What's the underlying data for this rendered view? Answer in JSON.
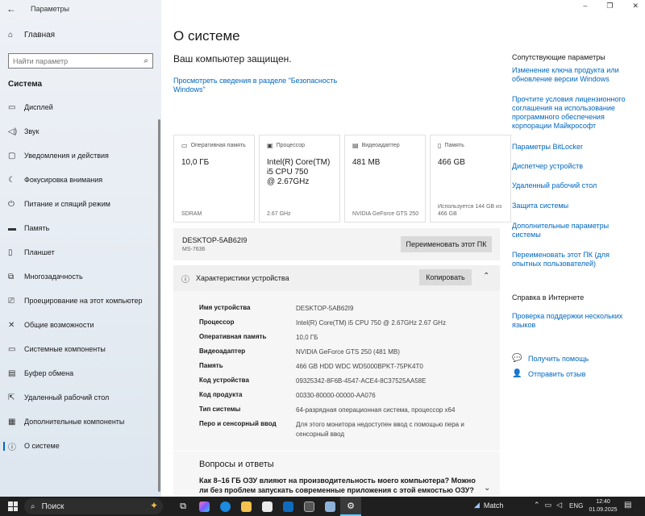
{
  "window": {
    "title": "Параметры",
    "controls": [
      "–",
      "❐",
      "✕"
    ]
  },
  "sidebar": {
    "home": "Главная",
    "search_placeholder": "Найти параметр",
    "section": "Система",
    "items": [
      {
        "label": "Дисплей",
        "icon": "display-icon"
      },
      {
        "label": "Звук",
        "icon": "sound-icon"
      },
      {
        "label": "Уведомления и действия",
        "icon": "notifications-icon"
      },
      {
        "label": "Фокусировка внимания",
        "icon": "focus-assist-icon"
      },
      {
        "label": "Питание и спящий режим",
        "icon": "power-icon"
      },
      {
        "label": "Память",
        "icon": "storage-icon"
      },
      {
        "label": "Планшет",
        "icon": "tablet-icon"
      },
      {
        "label": "Многозадачность",
        "icon": "multitasking-icon"
      },
      {
        "label": "Проецирование на этот компьютер",
        "icon": "projecting-icon"
      },
      {
        "label": "Общие возможности",
        "icon": "shared-experiences-icon"
      },
      {
        "label": "Системные компоненты",
        "icon": "system-components-icon"
      },
      {
        "label": "Буфер обмена",
        "icon": "clipboard-icon"
      },
      {
        "label": "Удаленный рабочий стол",
        "icon": "remote-desktop-icon"
      },
      {
        "label": "Дополнительные компоненты",
        "icon": "optional-features-icon"
      },
      {
        "label": "О системе",
        "icon": "info-icon"
      }
    ]
  },
  "main": {
    "title": "О системе",
    "protected": "Ваш компьютер защищен.",
    "security_link": "Просмотреть сведения в разделе \"Безопасность Windows\"",
    "cards": [
      {
        "label": "Оперативная память",
        "value": "10,0 ГБ",
        "sub": "SDRAM"
      },
      {
        "label": "Процессор",
        "value": "Intel(R) Core(TM)\ni5 CPU         750\n@ 2.67GHz",
        "sub": "2.67 GHz"
      },
      {
        "label": "Видеоадаптер",
        "value": "481 MB",
        "sub": "NVIDIA GeForce GTS 250"
      },
      {
        "label": "Память",
        "value": "466 GB",
        "sub": "Используется 144 GB из 466 GB"
      }
    ],
    "device_name": "DESKTOP-5AB62I9",
    "device_model": "MS-7636",
    "rename_button": "Переименовать этот ПК",
    "specs_title": "Характеристики устройства",
    "copy_button": "Копировать",
    "specs": [
      {
        "k": "Имя устройства",
        "v": "DESKTOP-5AB62I9"
      },
      {
        "k": "Процессор",
        "v": "Intel(R) Core(TM) i5 CPU       750  @ 2.67GHz   2.67 GHz"
      },
      {
        "k": "Оперативная память",
        "v": "10,0 ГБ"
      },
      {
        "k": "Видеоадаптер",
        "v": "NVIDIA GeForce GTS 250 (481 MB)"
      },
      {
        "k": "Память",
        "v": "466 GB HDD WDC WD5000BPKT-75PK4T0"
      },
      {
        "k": "Код устройства",
        "v": "09325342-8F6B-4547-ACE4-8C37525AA58E"
      },
      {
        "k": "Код продукта",
        "v": "00330-80000-00000-AA076"
      },
      {
        "k": "Тип системы",
        "v": "64-разрядная операционная система, процессор x64"
      },
      {
        "k": "Перо и сенсорный ввод",
        "v": "Для этого монитора недоступен ввод с помощью пера и сенсорный ввод"
      }
    ],
    "qa_title": "Вопросы и ответы",
    "qa_question": "Как 8–16 ГБ ОЗУ влияют на производительность моего компьютера? Можно ли без проблем запускать современные приложения с этой емкостью ОЗУ?"
  },
  "related": {
    "title": "Сопутствующие параметры",
    "links": [
      "Изменение ключа продукта или обновление версии Windows",
      "Прочтите условия лицензионного соглашения на использование программного обеспечения корпорации Майкрософт",
      "Параметры BitLocker",
      "Диспетчер устройств",
      "Удаленный рабочий стол",
      "Защита системы",
      "Дополнительные параметры системы",
      "Переименовать этот ПК (для опытных пользователей)"
    ],
    "help_title": "Справка в Интернете",
    "help_link": "Проверка поддержки нескольких языков",
    "get_help": "Получить помощь",
    "feedback": "Отправить отзыв"
  },
  "taskbar": {
    "search": "Поиск",
    "weather": "Match",
    "lang": "ENG",
    "time": "12:40",
    "date": "01.09.2025"
  }
}
